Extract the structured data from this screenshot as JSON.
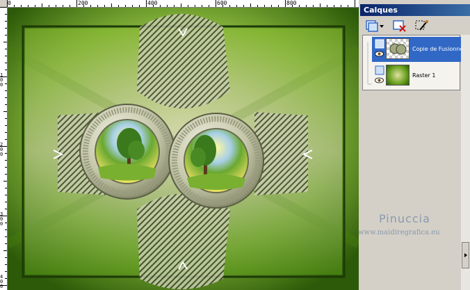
{
  "ruler": {
    "top_labels": [
      "0",
      "200",
      "400",
      "600",
      "800"
    ],
    "left_labels": [
      "1",
      "0",
      "0",
      "2",
      "0",
      "0",
      "3",
      "0",
      "0",
      "4",
      "0",
      "0",
      "5",
      "0"
    ]
  },
  "layers_panel": {
    "title": "Calques",
    "layers": [
      {
        "name": "Copie de Fusionné",
        "selected": true
      },
      {
        "name": "Raster 1",
        "selected": false
      }
    ]
  },
  "watermark": {
    "name": "Pinuccia",
    "url": "www.maidiregrafica.eu"
  },
  "colors": {
    "title_bar_start": "#0a246a",
    "title_bar_end": "#3a6ea5",
    "selected_layer": "#3168c5",
    "canvas_green": "#6aa01c",
    "watermark_text": "#8a9aac"
  },
  "icons": {
    "new_layer": "new-layer-icon",
    "delete_layer": "delete-layer-icon",
    "properties": "properties-brush-icon",
    "visibility": "eye-icon"
  }
}
